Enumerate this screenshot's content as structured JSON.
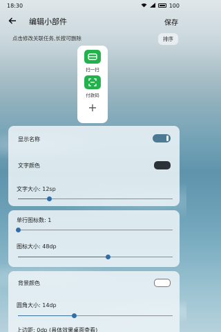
{
  "status": {
    "time": "18:30",
    "battery": "100"
  },
  "header": {
    "title": "编辑小部件",
    "save_label": "保存"
  },
  "hint": "点击修改关联任务,长按可删除",
  "sort_label": "排序",
  "widget": {
    "items": [
      {
        "label": "扫一扫",
        "icon": "scan-icon"
      },
      {
        "label": "付款码",
        "icon": "payment-code-icon"
      }
    ],
    "add_label": "+"
  },
  "display": {
    "show_name_label": "显示名称",
    "show_name_on": true,
    "text_color_label": "文字颜色",
    "text_color": "#2c3338",
    "text_size_label": "文字大小: 12sp",
    "text_size_fraction": 0.2
  },
  "icons": {
    "per_row_label": "单行图标数: 1",
    "per_row_fraction": 0.0,
    "icon_size_label": "图标大小: 48dp",
    "icon_size_fraction": 0.58
  },
  "background": {
    "bg_color_label": "背景颜色",
    "bg_color": "#ffffff",
    "radius_label": "圆角大小: 14dp",
    "radius_fraction": 0.36,
    "top_margin_label": "上边距: 0dp (具体效果桌面查看)"
  },
  "colors": {
    "accent": "#2f6ea8",
    "green": "#22b14c"
  }
}
